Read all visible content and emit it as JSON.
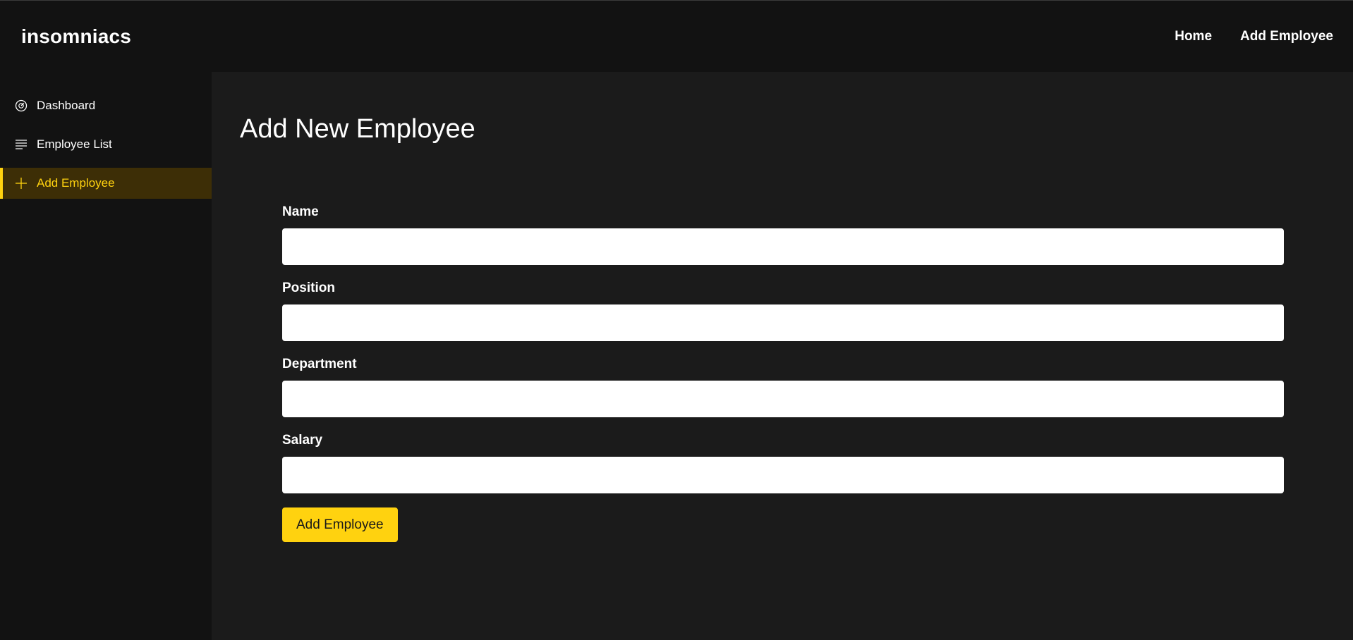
{
  "app": {
    "brand": "insomniacs"
  },
  "header": {
    "nav": [
      {
        "label": "Home"
      },
      {
        "label": "Add Employee"
      }
    ]
  },
  "sidebar": {
    "items": [
      {
        "label": "Dashboard",
        "icon": "dashboard-gauge-icon",
        "active": false
      },
      {
        "label": "Employee List",
        "icon": "list-lines-icon",
        "active": false
      },
      {
        "label": "Add Employee",
        "icon": "plus-icon",
        "active": true
      }
    ]
  },
  "main": {
    "title": "Add New Employee",
    "form": {
      "fields": [
        {
          "label": "Name",
          "value": "",
          "placeholder": ""
        },
        {
          "label": "Position",
          "value": "",
          "placeholder": ""
        },
        {
          "label": "Department",
          "value": "",
          "placeholder": ""
        },
        {
          "label": "Salary",
          "value": "",
          "placeholder": ""
        }
      ],
      "submit_label": "Add Employee"
    }
  },
  "colors": {
    "accent": "#ffd20f",
    "active_bg": "#3d2e06",
    "header_bg": "#121212",
    "content_bg": "#1b1b1b"
  }
}
